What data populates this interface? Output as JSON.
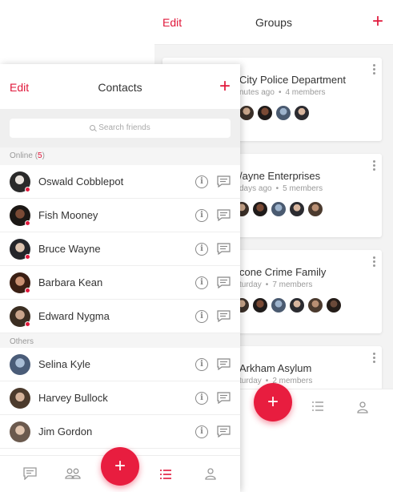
{
  "groups_screen": {
    "edit_label": "Edit",
    "title": "Groups",
    "add_label": "+",
    "groups": [
      {
        "name": "City Police Department",
        "time": "nutes ago",
        "members": "4 members"
      },
      {
        "name": "/ayne Enterprises",
        "time": "days ago",
        "members": "5 members"
      },
      {
        "name": "cone Crime Family",
        "time": "turday",
        "members": "7 members"
      },
      {
        "name": "Arkham Asylum",
        "time": "turday",
        "members": "2 members"
      }
    ],
    "fab_label": "+",
    "tabs": [
      "list-icon",
      "profile-icon"
    ]
  },
  "contacts_screen": {
    "edit_label": "Edit",
    "title": "Contacts",
    "add_label": "+",
    "search_placeholder": "Search friends",
    "online_section": {
      "label": "Online",
      "count_open": "(",
      "count": "5",
      "count_close": ")"
    },
    "online_contacts": [
      {
        "name": "Oswald Cobblepot"
      },
      {
        "name": "Fish Mooney"
      },
      {
        "name": "Bruce Wayne"
      },
      {
        "name": "Barbara Kean"
      },
      {
        "name": "Edward Nygma"
      }
    ],
    "others_section": {
      "label": "Others"
    },
    "other_contacts": [
      {
        "name": "Selina Kyle"
      },
      {
        "name": "Harvey Bullock"
      },
      {
        "name": "Jim Gordon"
      }
    ],
    "info_glyph": "i",
    "fab_label": "+",
    "tabs": [
      "chat-icon",
      "groups-icon",
      "list-icon",
      "profile-icon"
    ]
  },
  "colors": {
    "accent": "#e0173a",
    "fab": "#e81d3f",
    "section_bg": "#f5f5f5",
    "muted_text": "#999999"
  }
}
